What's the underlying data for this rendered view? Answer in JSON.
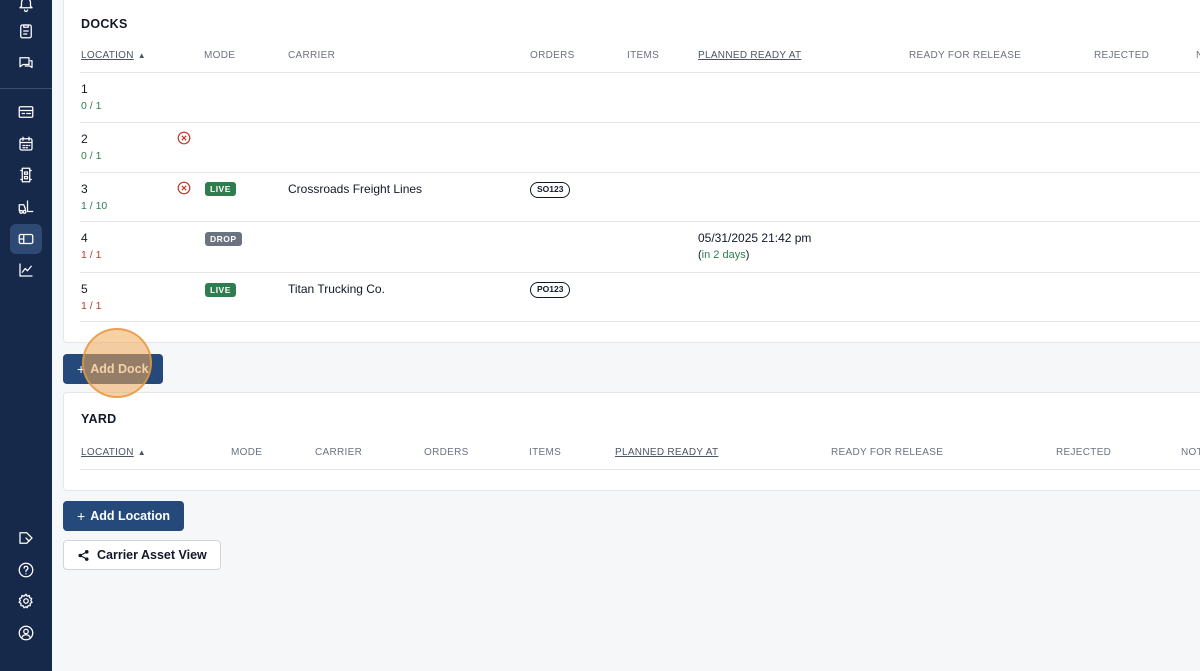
{
  "sidebar": {
    "icons": [
      "bell-icon",
      "clipboard-icon",
      "chat-icon",
      "list-card-icon",
      "calendar-icon",
      "dock-icon",
      "forklift-icon",
      "map-icon",
      "chart-icon",
      "tag-icon",
      "help-icon",
      "gear-icon",
      "user-icon"
    ],
    "active": "map-icon"
  },
  "docks": {
    "title": "DOCKS",
    "headers": {
      "location": "LOCATION",
      "mode": "MODE",
      "carrier": "CARRIER",
      "orders": "ORDERS",
      "items": "ITEMS",
      "planned_ready_at": "PLANNED READY AT",
      "ready_for_release": "READY FOR RELEASE",
      "rejected": "REJECTED",
      "notes": "N"
    },
    "rows": [
      {
        "location": "1",
        "capacity": "0 / 1",
        "capacity_status": "green",
        "mode": "",
        "carrier": "",
        "order": "",
        "planned": "",
        "planned_relative": ""
      },
      {
        "location": "2",
        "capacity": "0 / 1",
        "capacity_status": "green",
        "mode": "",
        "carrier": "",
        "order": "",
        "planned": "",
        "planned_relative": ""
      },
      {
        "location": "3",
        "capacity": "1 / 10",
        "capacity_status": "green",
        "mode": "LIVE",
        "carrier": "Crossroads Freight Lines",
        "order": "SO123",
        "planned": "",
        "planned_relative": ""
      },
      {
        "location": "4",
        "capacity": "1 / 1",
        "capacity_status": "red",
        "mode": "DROP",
        "carrier": "",
        "order": "",
        "planned": "05/31/2025 21:42 pm",
        "planned_relative": "in 2 days"
      },
      {
        "location": "5",
        "capacity": "1 / 1",
        "capacity_status": "red",
        "mode": "LIVE",
        "carrier": "Titan Trucking Co.",
        "order": "PO123",
        "planned": "",
        "planned_relative": ""
      }
    ]
  },
  "add_dock_label": "Add Dock",
  "yard": {
    "title": "YARD",
    "headers": {
      "location": "LOCATION",
      "mode": "MODE",
      "carrier": "CARRIER",
      "orders": "ORDERS",
      "items": "ITEMS",
      "planned_ready_at": "PLANNED READY AT",
      "ready_for_release": "READY FOR RELEASE",
      "rejected": "REJECTED",
      "notes": "NOT"
    }
  },
  "add_location_label": "Add Location",
  "carrier_asset_view_label": "Carrier Asset View"
}
